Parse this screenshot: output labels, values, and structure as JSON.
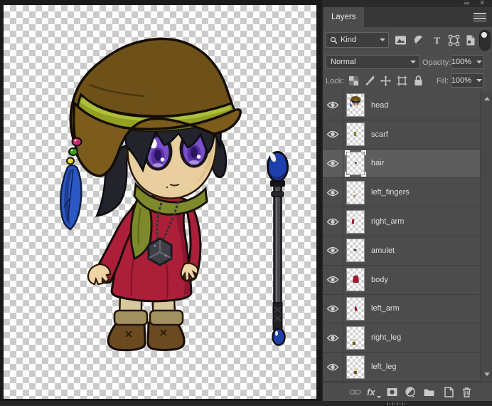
{
  "window": {
    "collapse_glyph": "««",
    "close_glyph": "✕"
  },
  "panel": {
    "tab_title": "Layers",
    "filter": {
      "kind_label": "Kind",
      "type_icons": [
        "pixel-layer-filter",
        "adjustment-layer-filter",
        "type-layer-filter",
        "shape-layer-filter",
        "smart-object-filter"
      ],
      "toggle_state": "on"
    },
    "blend": {
      "mode": "Normal",
      "opacity_label": "Opacity:",
      "opacity_value": "100%"
    },
    "lock": {
      "label": "Lock:",
      "icons": [
        "lock-transparent-pixels",
        "lock-image-pixels",
        "lock-position",
        "lock-artboard",
        "lock-all"
      ],
      "fill_label": "Fill:",
      "fill_value": "100%"
    },
    "layers": [
      {
        "name": "head",
        "visible": true,
        "selected": false
      },
      {
        "name": "scarf",
        "visible": true,
        "selected": false
      },
      {
        "name": "hair",
        "visible": true,
        "selected": true
      },
      {
        "name": "left_fingers",
        "visible": true,
        "selected": false
      },
      {
        "name": "right_arm",
        "visible": true,
        "selected": false
      },
      {
        "name": "amulet",
        "visible": true,
        "selected": false
      },
      {
        "name": "body",
        "visible": true,
        "selected": false
      },
      {
        "name": "left_arm",
        "visible": true,
        "selected": false
      },
      {
        "name": "right_leg",
        "visible": true,
        "selected": false
      },
      {
        "name": "left_leg",
        "visible": true,
        "selected": false
      }
    ],
    "footer": {
      "fx_label": "fx",
      "icons": [
        "link-layers",
        "layer-styles",
        "add-layer-mask",
        "new-adjustment-layer",
        "new-group",
        "new-layer",
        "delete-layer"
      ]
    }
  },
  "canvas_art": {
    "subject": "chibi witch character and staff on transparent checkerboard",
    "colors": {
      "hat": "#6e5118",
      "hat_band": "#93a122",
      "hair": "#23232b",
      "skin": "#e9cf9f",
      "eyes": "#7a4ecb",
      "scarf": "#7d8a2b",
      "dress": "#ab1f39",
      "legs": "#d6c99a",
      "boots": "#6b4a22",
      "feather": "#2b58c4",
      "staff_orb": "#1e40ad",
      "amulet": "#3f3f47",
      "checker": "#cbcbcb"
    }
  },
  "ui_colors": {
    "panel_bg": "#4c4c4c",
    "panel_dark": "#373737",
    "selected_row": "#5d5d5d",
    "text": "#dcdcdc",
    "border": "#3e3e3e"
  }
}
